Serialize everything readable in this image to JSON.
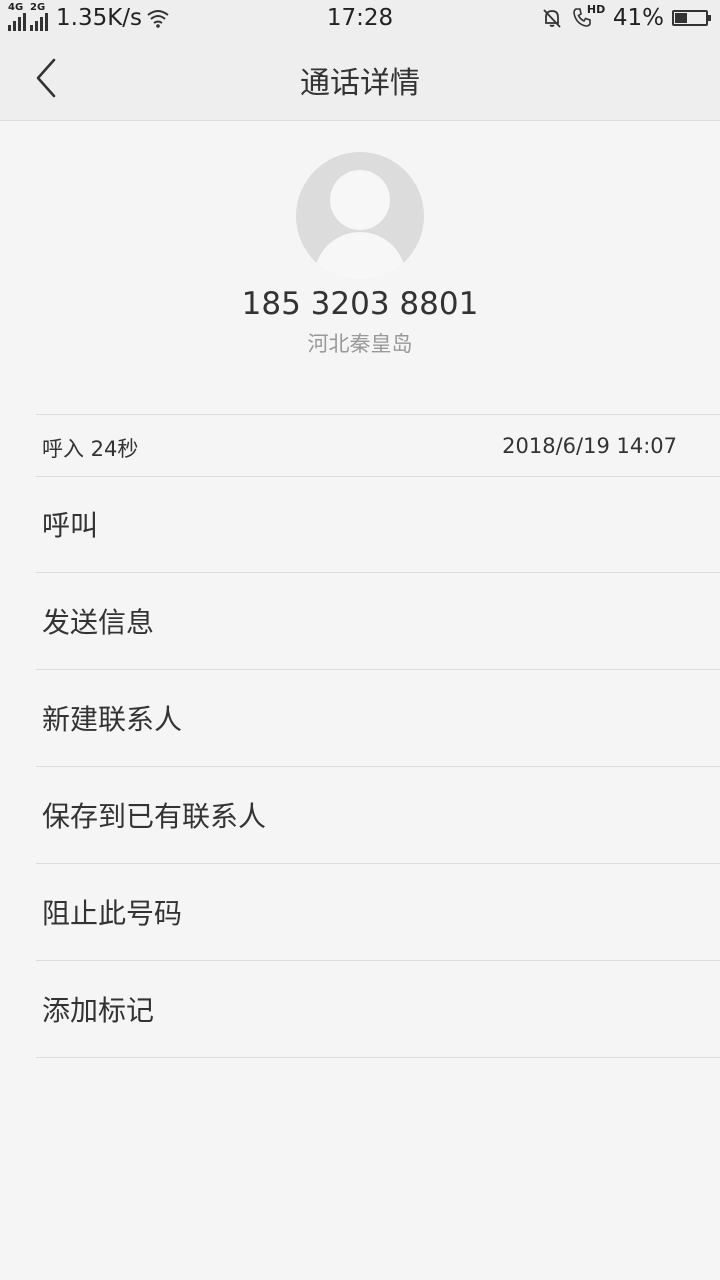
{
  "status_bar": {
    "network_1": "4G",
    "network_2": "2G",
    "speed": "1.35K/s",
    "time": "17:28",
    "hd_label": "HD",
    "battery_text": "41%",
    "battery_level": 0.41
  },
  "header": {
    "title": "通话详情"
  },
  "contact": {
    "number": "185 3203 8801",
    "location": "河北秦皇岛"
  },
  "call_log": {
    "type": "呼入  24秒",
    "datetime": "2018/6/19 14:07"
  },
  "actions": {
    "call": "呼叫",
    "send_message": "发送信息",
    "new_contact": "新建联系人",
    "save_to_existing": "保存到已有联系人",
    "block_number": "阻止此号码",
    "add_mark": "添加标记"
  }
}
